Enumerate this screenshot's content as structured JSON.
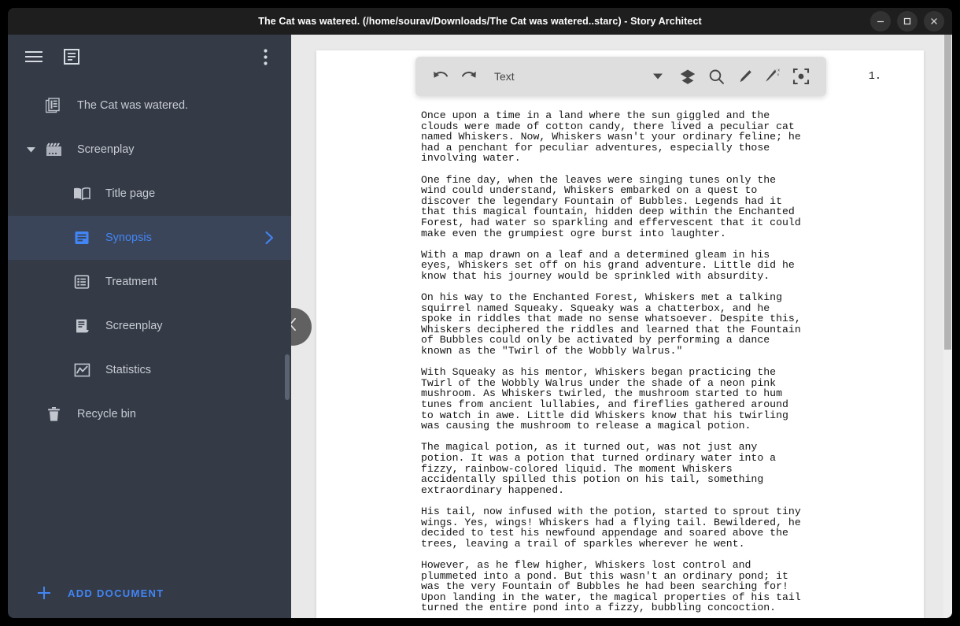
{
  "window": {
    "title": "The Cat was watered. (/home/sourav/Downloads/The Cat was watered..starc) - Story Architect",
    "minimize_label": "Minimize",
    "maximize_label": "Maximize",
    "close_label": "Close"
  },
  "sidebar": {
    "background_color": "#343a46",
    "accent_color": "#4285f4",
    "selected_background": "#3b4559",
    "top_actions": [
      {
        "name": "menu-icon",
        "label": "Menu"
      },
      {
        "name": "document-view-icon",
        "label": "Document view"
      },
      {
        "name": "more-vert-icon",
        "label": "More options"
      }
    ],
    "items": [
      {
        "label": "The Cat was watered.",
        "icon": "project-icon",
        "level": 0,
        "selected": false,
        "expandable": false
      },
      {
        "label": "Screenplay",
        "icon": "clapperboard-icon",
        "level": 1,
        "selected": false,
        "expandable": true,
        "expanded": true
      },
      {
        "label": "Title page",
        "icon": "book-icon",
        "level": 2,
        "selected": false,
        "expandable": false
      },
      {
        "label": "Synopsis",
        "icon": "synopsis-icon",
        "level": 2,
        "selected": true,
        "expandable": false
      },
      {
        "label": "Treatment",
        "icon": "treatment-icon",
        "level": 2,
        "selected": false,
        "expandable": false
      },
      {
        "label": "Screenplay",
        "icon": "script-icon",
        "level": 2,
        "selected": false,
        "expandable": false
      },
      {
        "label": "Statistics",
        "icon": "chart-icon",
        "level": 2,
        "selected": false,
        "expandable": false
      },
      {
        "label": "Recycle bin",
        "icon": "trash-icon",
        "level": 1,
        "selected": false,
        "expandable": false
      }
    ],
    "add_document_label": "ADD DOCUMENT"
  },
  "toolbar": {
    "undo_label": "Undo",
    "redo_label": "Redo",
    "style_value": "Text",
    "style_placeholder": "Text",
    "layers_label": "Layers",
    "search_label": "Search",
    "highlight_label": "Highlight",
    "magic_label": "AI assistant",
    "focus_label": "Focus mode"
  },
  "editor": {
    "collapse_handle_label": "Collapse panel",
    "page_number": "1.",
    "paragraphs": [
      "Once upon a time in a land where the sun giggled and the\nclouds were made of cotton candy, there lived a peculiar cat\nnamed Whiskers. Now, Whiskers wasn't your ordinary feline; he\nhad a penchant for peculiar adventures, especially those\ninvolving water.",
      "One fine day, when the leaves were singing tunes only the\nwind could understand, Whiskers embarked on a quest to\ndiscover the legendary Fountain of Bubbles. Legends had it\nthat this magical fountain, hidden deep within the Enchanted\nForest, had water so sparkling and effervescent that it could\nmake even the grumpiest ogre burst into laughter.",
      "With a map drawn on a leaf and a determined gleam in his\neyes, Whiskers set off on his grand adventure. Little did he\nknow that his journey would be sprinkled with absurdity.",
      "On his way to the Enchanted Forest, Whiskers met a talking\nsquirrel named Squeaky. Squeaky was a chatterbox, and he\nspoke in riddles that made no sense whatsoever. Despite this,\nWhiskers deciphered the riddles and learned that the Fountain\nof Bubbles could only be activated by performing a dance\nknown as the \"Twirl of the Wobbly Walrus.\"",
      "With Squeaky as his mentor, Whiskers began practicing the\nTwirl of the Wobbly Walrus under the shade of a neon pink\nmushroom. As Whiskers twirled, the mushroom started to hum\ntunes from ancient lullabies, and fireflies gathered around\nto watch in awe. Little did Whiskers know that his twirling\nwas causing the mushroom to release a magical potion.",
      "The magical potion, as it turned out, was not just any\npotion. It was a potion that turned ordinary water into a\nfizzy, rainbow-colored liquid. The moment Whiskers\naccidentally spilled this potion on his tail, something\nextraordinary happened.",
      "His tail, now infused with the potion, started to sprout tiny\nwings. Yes, wings! Whiskers had a flying tail. Bewildered, he\ndecided to test his newfound appendage and soared above the\ntrees, leaving a trail of sparkles wherever he went.",
      "However, as he flew higher, Whiskers lost control and\nplummeted into a pond. But this wasn't an ordinary pond; it\nwas the very Fountain of Bubbles he had been searching for!\nUpon landing in the water, the magical properties of his tail\nturned the entire pond into a fizzy, bubbling concoction."
    ]
  }
}
